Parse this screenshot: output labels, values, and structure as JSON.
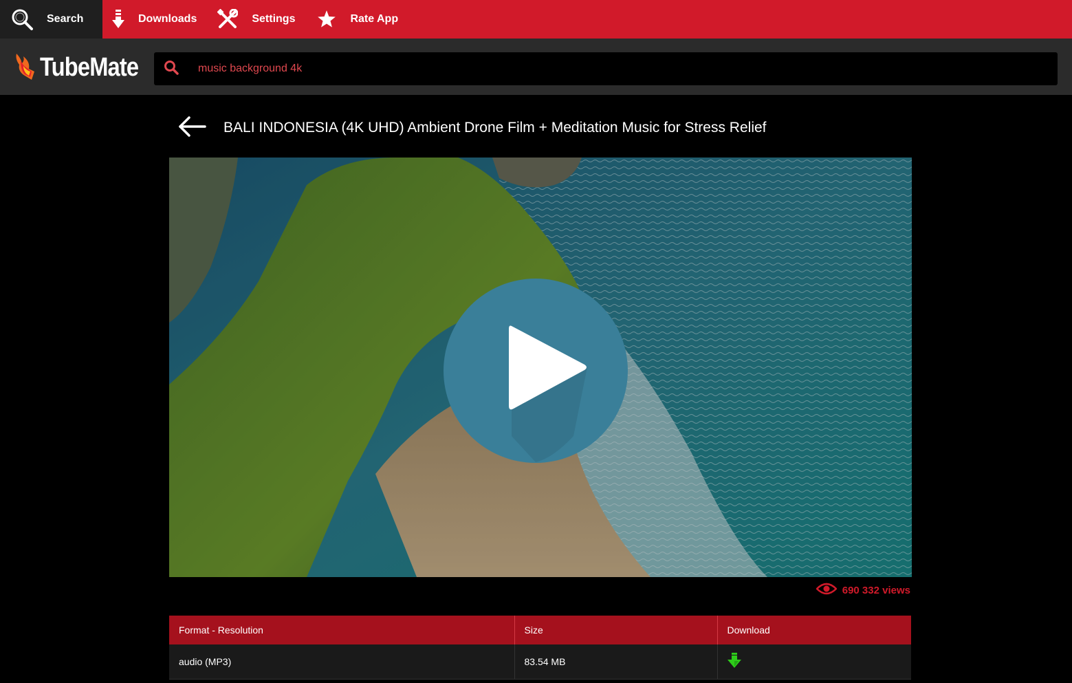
{
  "topnav": {
    "search_label": "Search",
    "downloads_label": "Downloads",
    "settings_label": "Settings",
    "rate_label": "Rate App"
  },
  "header": {
    "logo_text": "TubeMate",
    "search_value": "music background 4k"
  },
  "video": {
    "title": "BALI INDONESIA (4K UHD) Ambient Drone Film + Meditation Music for Stress Relief",
    "views": "690 332 views"
  },
  "formats_table": {
    "headers": [
      "Format - Resolution",
      "Size",
      "Download"
    ],
    "rows": [
      {
        "format": "audio (MP3)",
        "size": "83.54 MB"
      }
    ]
  },
  "colors": {
    "accent": "#d11a2a",
    "header_bg": "#2b2b2b",
    "table_header": "#a5111d",
    "play_button": "#3a7f99",
    "download_icon": "#2ecc1a"
  },
  "icons": [
    "search-icon",
    "download-arrow-icon",
    "tools-icon",
    "star-icon",
    "flame-logo-icon",
    "back-arrow-icon",
    "play-icon",
    "eye-icon",
    "download-green-icon"
  ]
}
